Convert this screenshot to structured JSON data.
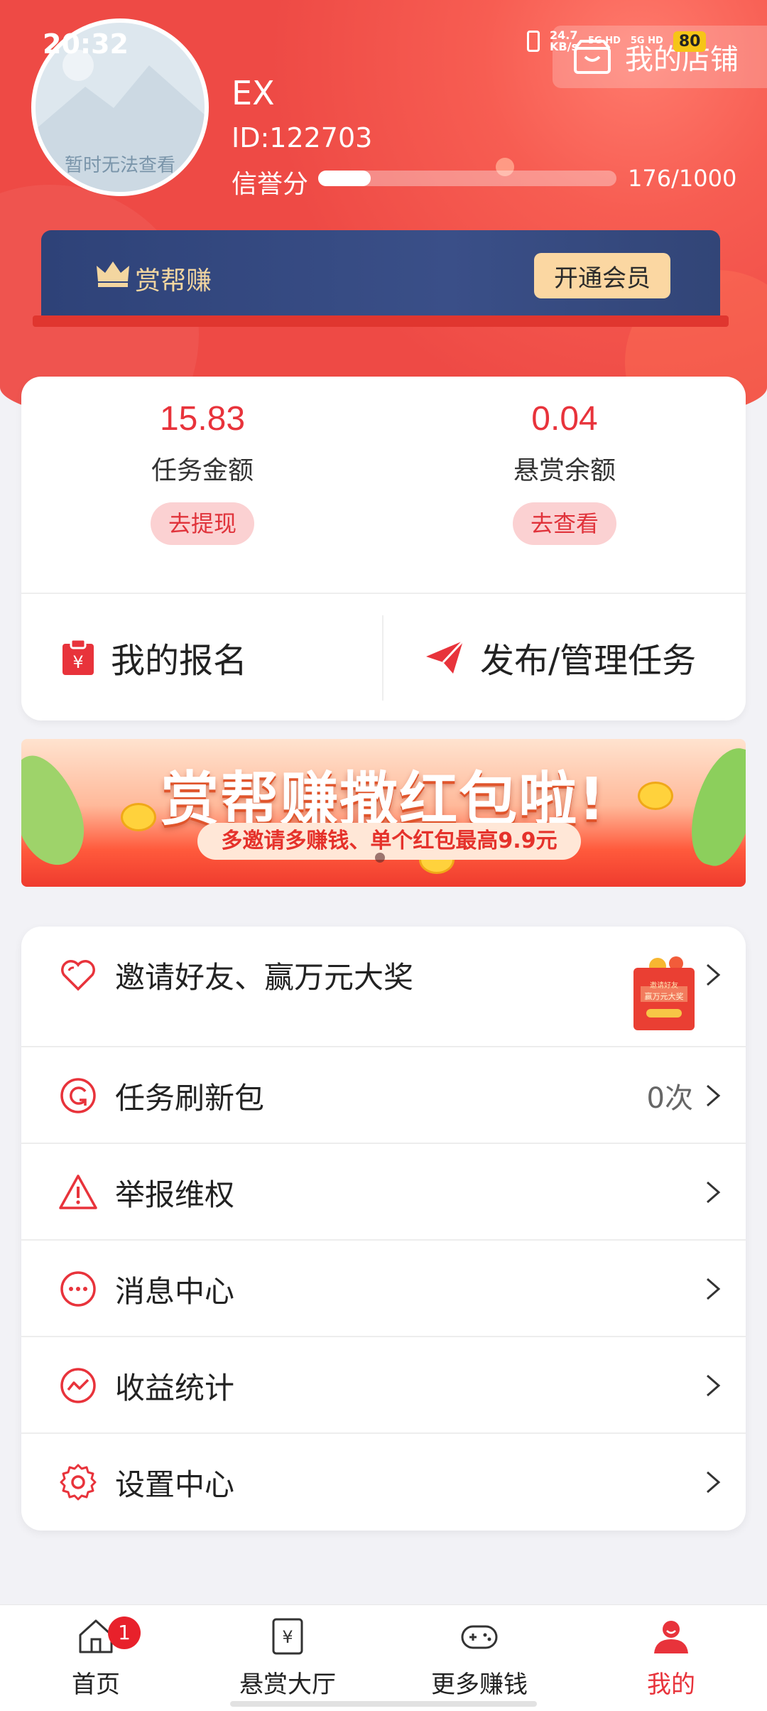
{
  "status_bar": {
    "time": "20:32",
    "speed": "24.7",
    "speed_unit": "KB/s",
    "net1": "5G HD",
    "net2": "5G HD",
    "battery": "80"
  },
  "header": {
    "store_label": "我的店铺",
    "avatar_placeholder": "暂时无法查看",
    "username": "EX",
    "user_id": "ID:122703",
    "credit_label": "信誉分",
    "credit_value": "176/1000",
    "credit_fraction": 0.176,
    "vip_label": "赏帮赚",
    "vip_button": "开通会员"
  },
  "balance": {
    "task_amount": "15.83",
    "task_label": "任务金额",
    "task_button": "去提现",
    "reward_amount": "0.04",
    "reward_label": "悬赏余额",
    "reward_button": "去查看",
    "my_signup": "我的报名",
    "publish_manage": "发布/管理任务"
  },
  "banner": {
    "title": "赏帮赚撒红包啦!",
    "subtitle": "多邀请多赚钱、单个红包最高9.9元"
  },
  "menu": {
    "invite": "邀请好友、赢万元大奖",
    "refresh_pack": "任务刷新包",
    "refresh_count": "0次",
    "report": "举报维权",
    "messages": "消息中心",
    "income": "收益统计",
    "settings": "设置中心",
    "redpack_line1": "邀请好友",
    "redpack_line2": "赢万元大奖"
  },
  "tabbar": {
    "home": "首页",
    "home_badge": "1",
    "reward_hall": "悬赏大厅",
    "more_earn": "更多赚钱",
    "mine": "我的"
  },
  "colors": {
    "brand_red": "#e8333b",
    "header_red": "#f75d52",
    "vip_navy": "#2e4278",
    "vip_gold": "#fbd7a2"
  }
}
